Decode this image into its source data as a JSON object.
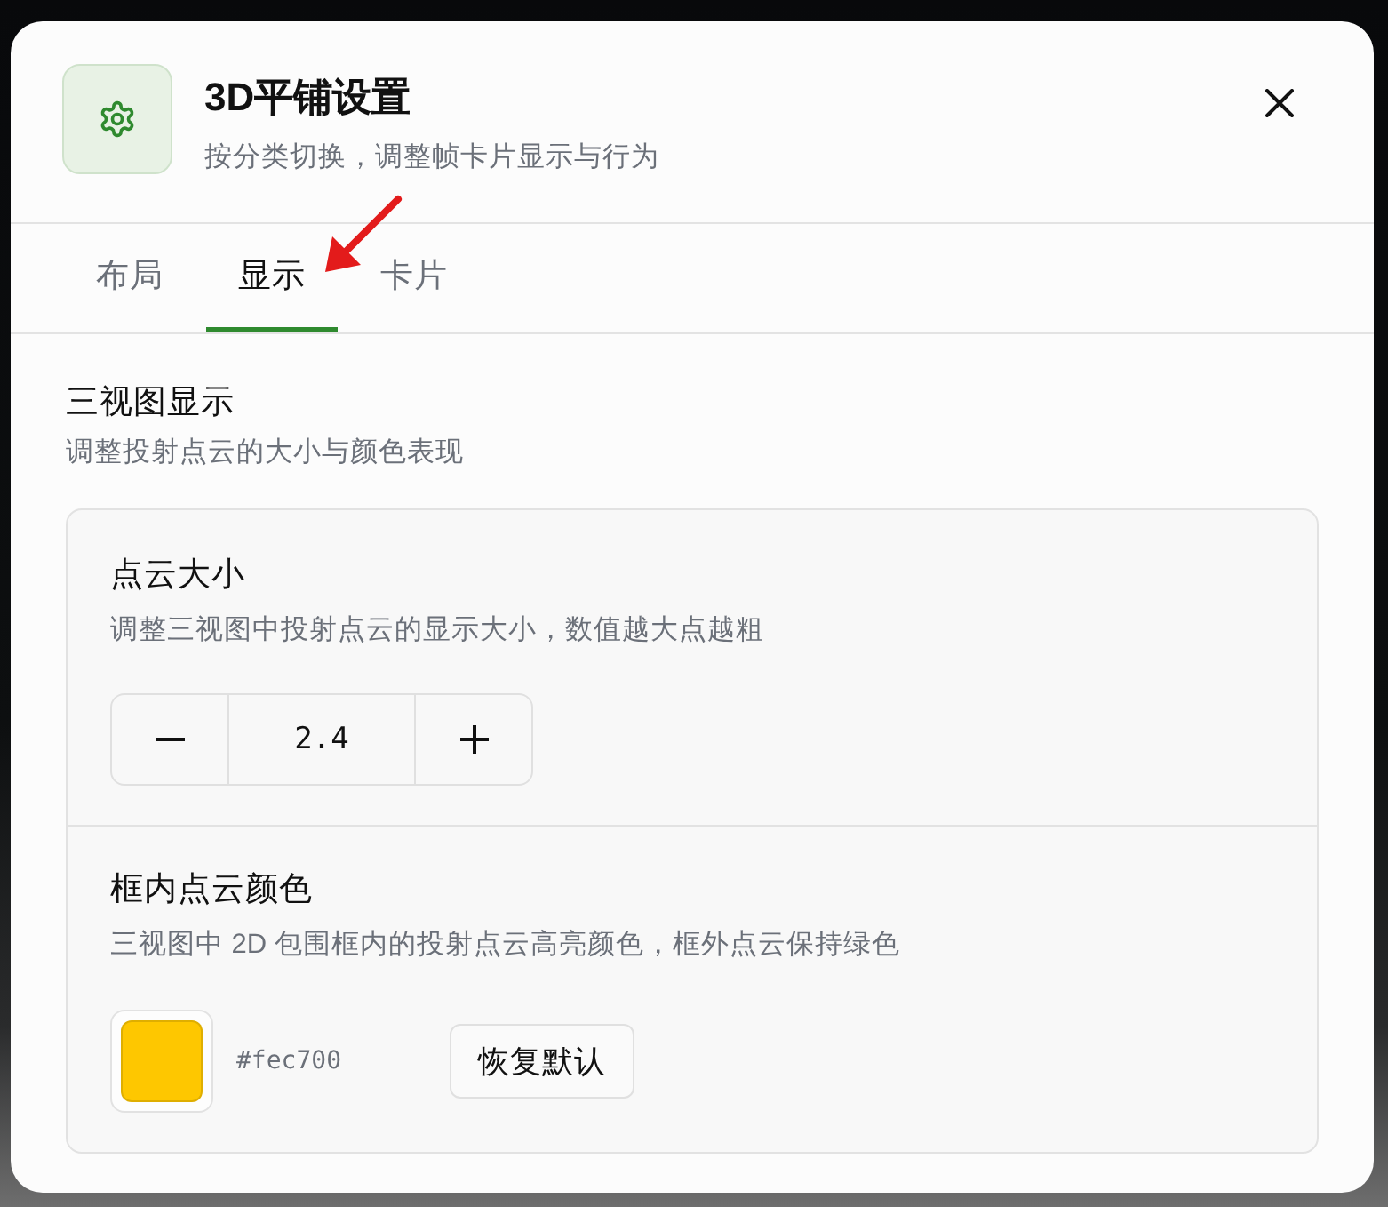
{
  "dialog": {
    "title": "3D平铺设置",
    "subtitle": "按分类切换，调整帧卡片显示与行为"
  },
  "tabs": [
    {
      "label": "布局",
      "selected": false
    },
    {
      "label": "显示",
      "selected": true
    },
    {
      "label": "卡片",
      "selected": false
    }
  ],
  "annotations": [
    {
      "kind": "arrow"
    }
  ],
  "section": {
    "title": "三视图显示",
    "description": "调整投射点云的大小与颜色表现"
  },
  "settings": [
    {
      "kind": "stepper",
      "title": "点云大小",
      "description": "调整三视图中投射点云的显示大小，数值越大点越粗",
      "value": "2.4"
    },
    {
      "kind": "color",
      "title": "框内点云颜色",
      "description": "三视图中 2D 包围框内的投射点云高亮颜色，框外点云保持绿色",
      "color": "#fec700",
      "hex": "#fec700",
      "reset_label": "恢复默认"
    }
  ]
}
